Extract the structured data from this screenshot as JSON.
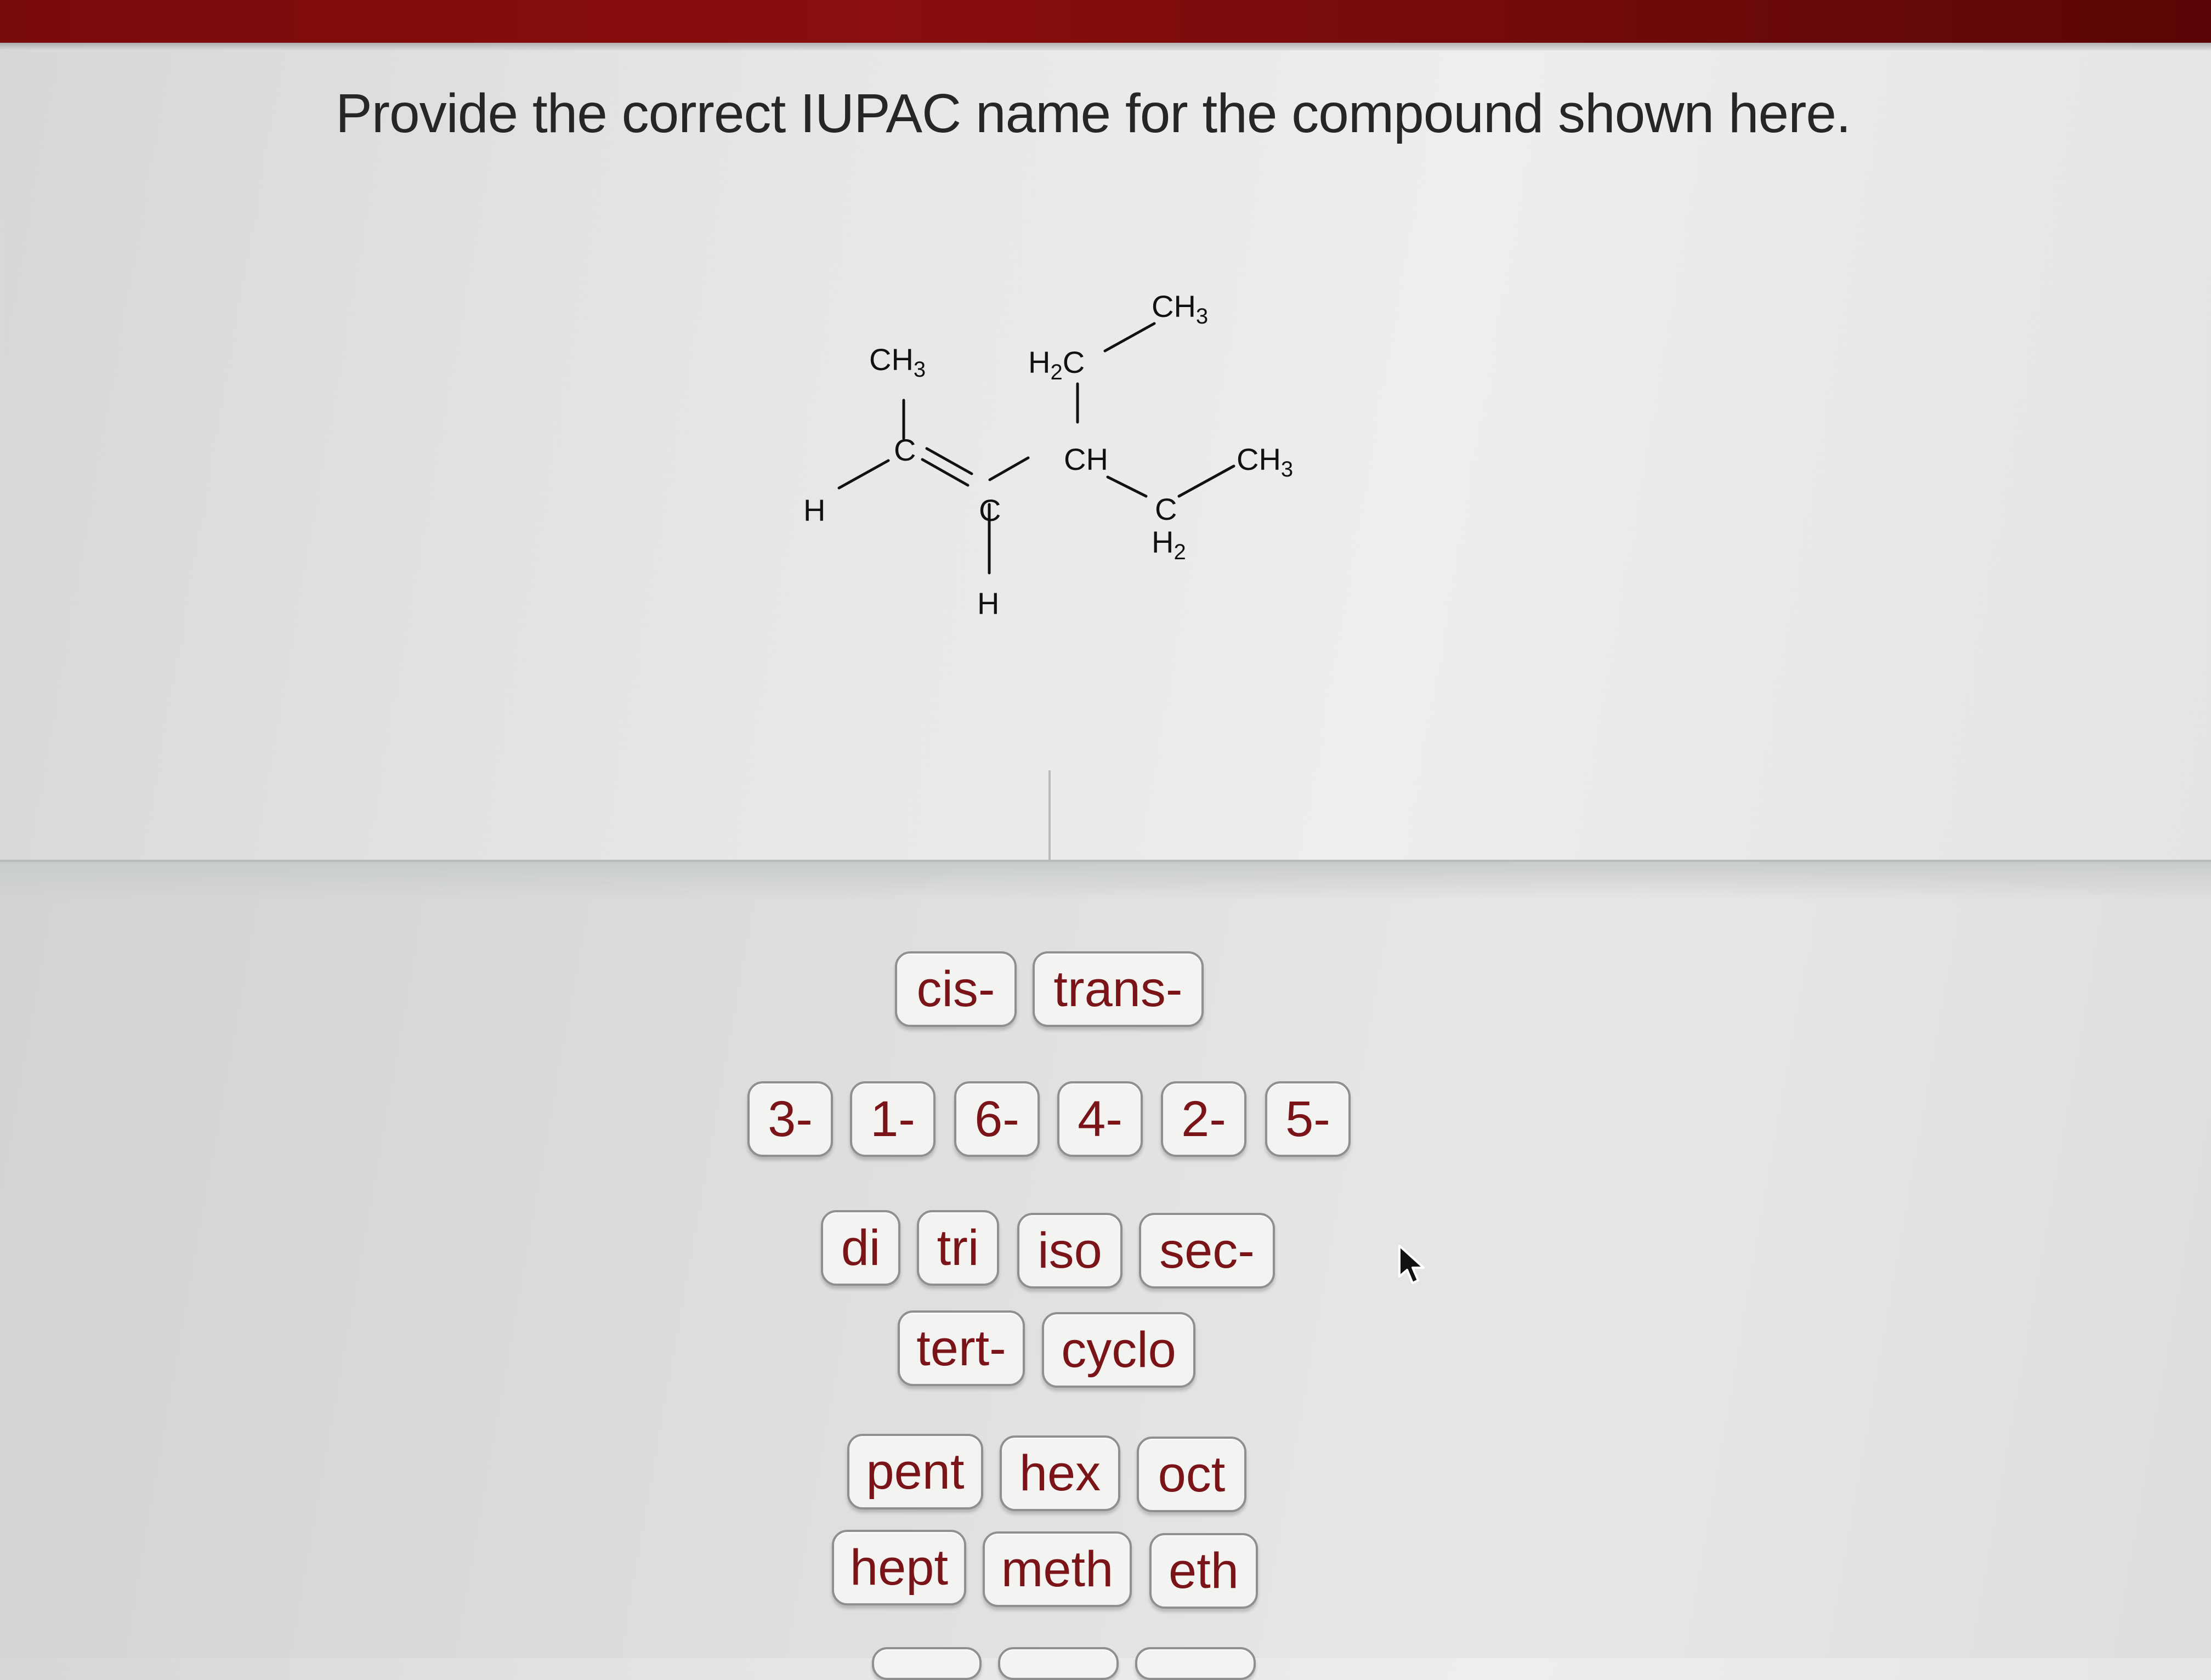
{
  "question": {
    "text": "Provide the correct IUPAC name for the compound shown here."
  },
  "molecule": {
    "labels": {
      "ch3_left": "CH3",
      "h2c": "H2C",
      "ch3_top": "CH3",
      "c1": "C",
      "c2": "C",
      "ch": "CH",
      "ch3_right": "CH3",
      "h_left": "H",
      "h_bottom": "H",
      "c_h2": "C",
      "h2": "H2"
    }
  },
  "tiles": {
    "stereo": [
      "cis-",
      "trans-"
    ],
    "locants": [
      "3-",
      "1-",
      "6-",
      "4-",
      "2-",
      "5-"
    ],
    "prefixes_row1": [
      "di",
      "tri",
      "iso",
      "sec-"
    ],
    "prefixes_row2": [
      "tert-",
      "cyclo"
    ],
    "roots_row1": [
      "pent",
      "hex",
      "oct"
    ],
    "roots_row2": [
      "hept",
      "meth",
      "eth"
    ]
  }
}
